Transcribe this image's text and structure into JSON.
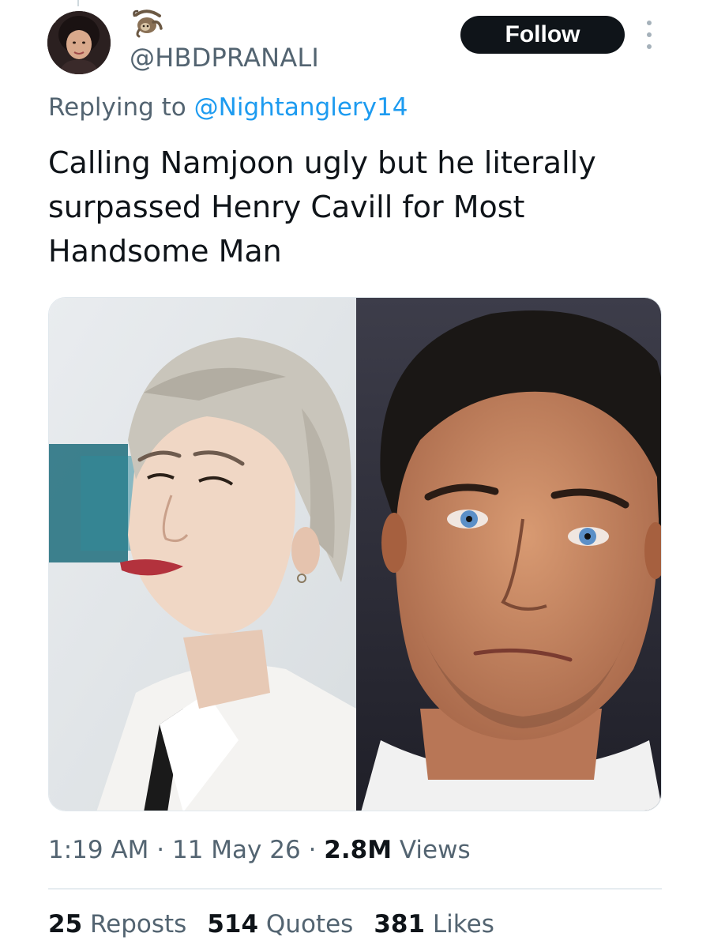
{
  "tweet": {
    "handle": "@HBDPRANALI",
    "follow_label": "Follow",
    "replying_prefix": "Replying to",
    "replying_to": "@Nightanglery14",
    "text": "Calling Namjoon ugly but he literally surpassed Henry Cavill for Most Handsome Man",
    "time": "1:19 AM",
    "date": "11 May 26",
    "views_count": "2.8M",
    "views_label": "Views",
    "separator": "·"
  },
  "stats": [
    {
      "count": "25",
      "label": "Reposts"
    },
    {
      "count": "514",
      "label": "Quotes"
    },
    {
      "count": "381",
      "label": "Likes"
    }
  ],
  "icons": {
    "badge": "sloth-emoji-icon",
    "more": "more-options-icon"
  },
  "colors": {
    "text": "#0f1419",
    "muted": "#536471",
    "link": "#1d9bf0",
    "follow_bg": "#0f1419"
  }
}
